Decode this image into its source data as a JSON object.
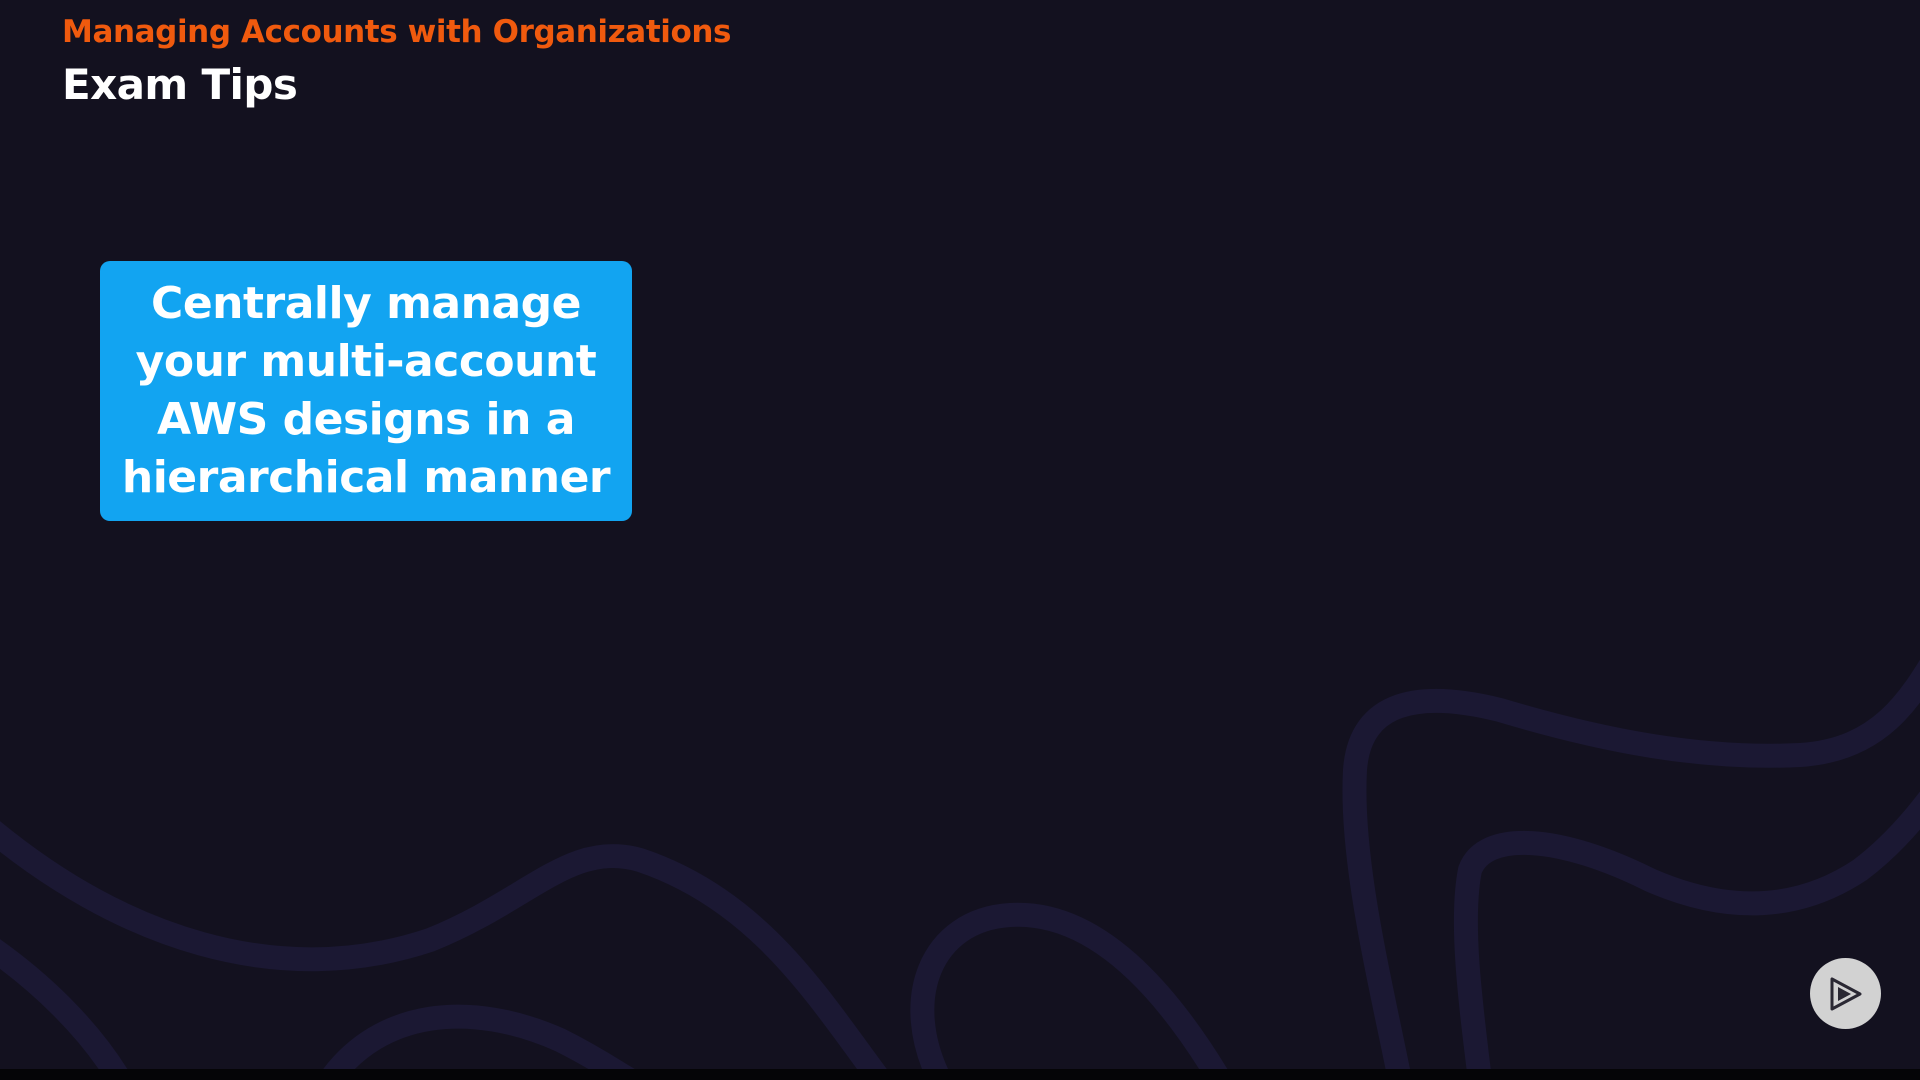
{
  "header": {
    "course_title": "Managing Accounts with Organizations",
    "section_title": "Exam Tips"
  },
  "tip_card": {
    "lines": [
      "Centrally manage",
      "your multi-account",
      "AWS designs in a",
      "hierarchical manner"
    ]
  },
  "controls": {
    "play_icon": "play-logo-icon"
  },
  "colors": {
    "background": "#13111f",
    "accent_orange": "#f05a0e",
    "card_blue": "#12a4f1",
    "text_white": "#ffffff",
    "wave_decor": "#1b1833",
    "play_button_bg": "#d2d2d2",
    "play_icon": "#2a2833"
  }
}
